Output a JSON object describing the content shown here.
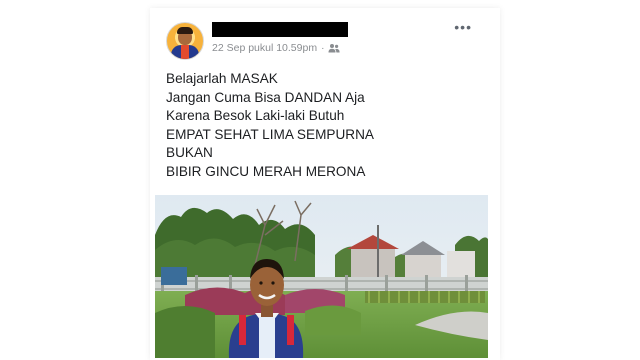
{
  "post": {
    "timestamp": "22 Sep pukul 10.59pm",
    "separator": "·",
    "audience_icon": "friends-icon",
    "more_icon": "more-options-icon",
    "lines": [
      "Belajarlah MASAK",
      "Jangan Cuma Bisa DANDAN Aja",
      "Karena Besok Laki-laki Butuh",
      "EMPAT SEHAT LIMA SEMPURNA",
      "BUKAN",
      "BIBIR GINCU MERAH MERONA"
    ],
    "photo_icon": "park-photo"
  },
  "colors": {
    "meta_text": "#8a8d91",
    "body_text": "#1c1e21"
  }
}
